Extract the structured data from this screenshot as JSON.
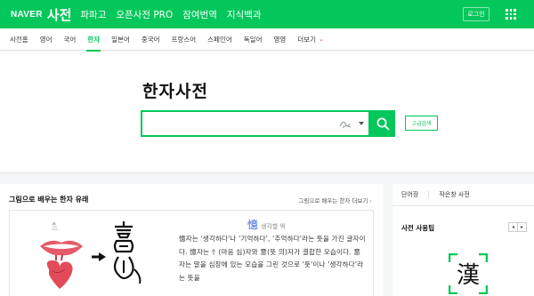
{
  "header": {
    "logo": "NAVER",
    "service": "사전",
    "nav": [
      "파파고",
      "오픈사전 PRO",
      "참여번역",
      "지식백과"
    ],
    "login": "로그인"
  },
  "tabs": [
    "사전홈",
    "영어",
    "국어",
    "한자",
    "일본어",
    "중국어",
    "프랑스어",
    "스페인어",
    "독일어",
    "영영",
    "더보기"
  ],
  "active_tab": "한자",
  "search": {
    "title": "한자사전",
    "value": "",
    "placeholder": "",
    "advanced": "고급검색"
  },
  "learn": {
    "title": "그림으로 배우는 한자 유래",
    "more": "그림으로 배우는 한자 더보기",
    "hanja": "憶",
    "hanja_meaning": "생각할 억",
    "description": "憶자는 '생각하다'나 '기억하다', '추억하다'라는 뜻을 가진 글자이다. 憶자는 忄(마음 심)자와 意(뜻 의)자가 결합한 모습이다. 意자는 말을 심장에 있는 모습을 그린 것으로 '뜻'이나 '생각하다'라는 뜻을"
  },
  "right": {
    "tabs": [
      "단어장",
      "작은창 사전"
    ],
    "tips_title": "사전 사용팁",
    "tip_glyph": "漢"
  },
  "colors": {
    "brand": "#03c75a",
    "hanja": "#2f5cd6"
  }
}
